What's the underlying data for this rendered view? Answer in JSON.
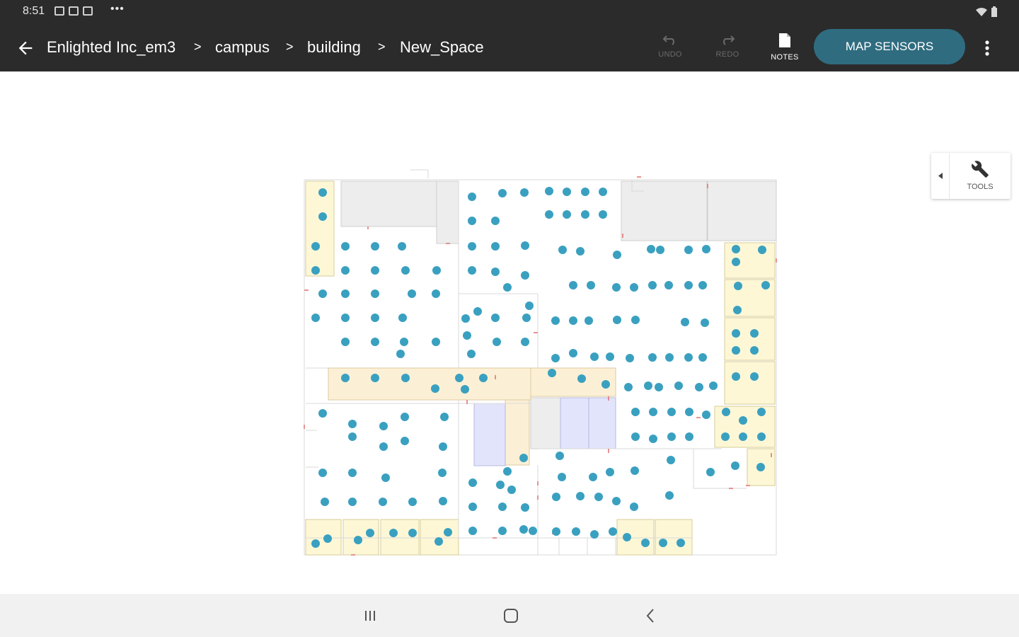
{
  "status_bar": {
    "time": "8:51",
    "icons": [
      "image-icon",
      "notification-icon",
      "notification-icon"
    ],
    "overflow": "•••",
    "right_icons": [
      "wifi-icon",
      "battery-icon"
    ]
  },
  "app_bar": {
    "breadcrumb": [
      "Enlighted Inc_em3",
      "campus",
      "building",
      "New_Space"
    ],
    "separator": ">",
    "undo_label": "UNDO",
    "redo_label": "REDO",
    "notes_label": "NOTES",
    "map_sensors_label": "MAP SENSORS"
  },
  "tools": {
    "label": "TOOLS"
  },
  "floorplan": {
    "sensor_color": "#3aa0c0",
    "room_fill": "#fdf7d6",
    "corridor_fill": "#fbf0d6",
    "grey_room_fill": "#ededed",
    "blue_room_fill": "#e2e4fb"
  },
  "colors": {
    "appbar": "#2b2b2b",
    "accent": "#2f6c80"
  }
}
